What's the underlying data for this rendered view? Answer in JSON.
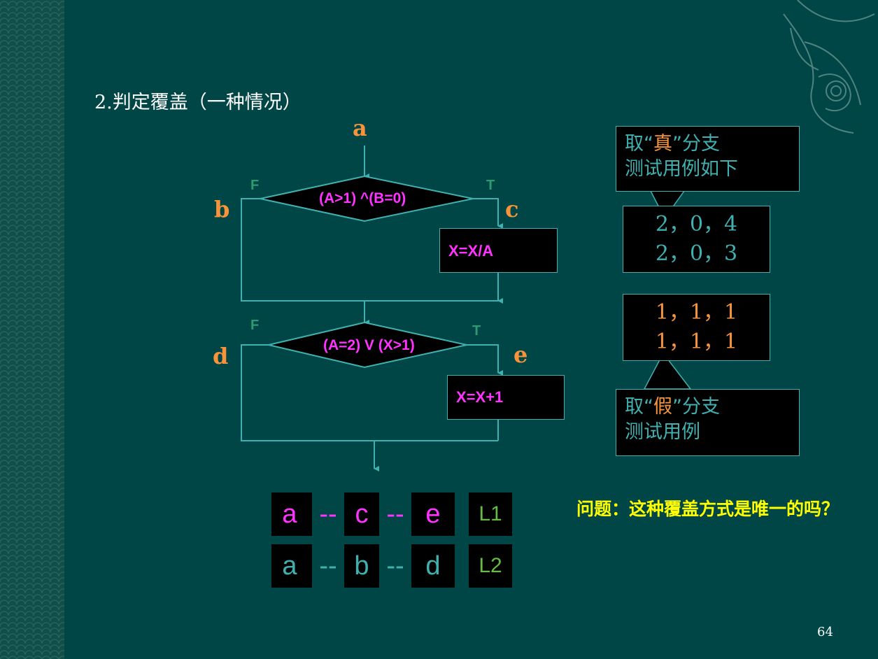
{
  "slide": {
    "title": "2.判定覆盖（一种情况）",
    "page_number": "64"
  },
  "flowchart": {
    "nodes": {
      "a": "a",
      "b": "b",
      "c": "c",
      "d": "d",
      "e": "e"
    },
    "decision1": {
      "text": "(A>1) ^(B=0)",
      "false_label": "F",
      "true_label": "T"
    },
    "process1": "X=X/A",
    "decision2": {
      "text": "(A=2) V (X>1)",
      "false_label": "F",
      "true_label": "T"
    },
    "process2": "X=X+1"
  },
  "callouts": {
    "true_branch": {
      "line1_prefix": "取“",
      "highlight": "真",
      "line1_suffix": "”分支",
      "line2": "测试用例如下"
    },
    "false_branch": {
      "line1_prefix": "取“",
      "highlight": "假",
      "line1_suffix": "”分支",
      "line2": "测试用例"
    }
  },
  "test_cases": {
    "true_cases": [
      "2，0，4",
      "2，0，3"
    ],
    "false_cases": [
      "1，1，1",
      "1，1，1"
    ]
  },
  "paths": {
    "L1": {
      "parts": [
        "a",
        "--",
        "c",
        "--",
        "e"
      ],
      "label": "L1"
    },
    "L2": {
      "parts": [
        "a",
        "--",
        "b",
        "--",
        "d"
      ],
      "label": "L2"
    }
  },
  "question": "问题：这种覆盖方式是唯一的吗？",
  "colors": {
    "background": "#004646",
    "line": "#40b0b0",
    "node_letter": "#f7943b",
    "decision_text": "#ff33ff",
    "tf_label": "#2e9a70",
    "question": "#ffff00",
    "path_label": "#66bb44"
  }
}
